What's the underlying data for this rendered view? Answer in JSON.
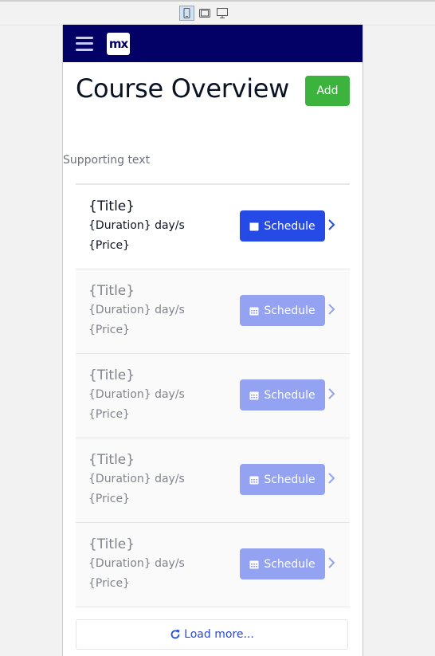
{
  "app": {
    "device_switch": [
      "phone-icon",
      "tablet-icon",
      "desktop-icon"
    ],
    "logo_text": "mx"
  },
  "page": {
    "title": "Course Overview",
    "add_label": "Add",
    "supporting_text": "Supporting text"
  },
  "courses": [
    {
      "title": "{Title}",
      "duration": "{Duration} day/s",
      "price": "{Price}",
      "button": "Schedule"
    },
    {
      "title": "{Title}",
      "duration": "{Duration} day/s",
      "price": "{Price}",
      "button": "Schedule"
    },
    {
      "title": "{Title}",
      "duration": "{Duration} day/s",
      "price": "{Price}",
      "button": "Schedule"
    },
    {
      "title": "{Title}",
      "duration": "{Duration} day/s",
      "price": "{Price}",
      "button": "Schedule"
    },
    {
      "title": "{Title}",
      "duration": "{Duration} day/s",
      "price": "{Price}",
      "button": "Schedule"
    }
  ],
  "load_more_label": "Load more...",
  "colors": {
    "navbar": "#030066",
    "primary": "#264ae5",
    "primary_disabled": "#93a3f1",
    "success": "#3cb33d"
  }
}
